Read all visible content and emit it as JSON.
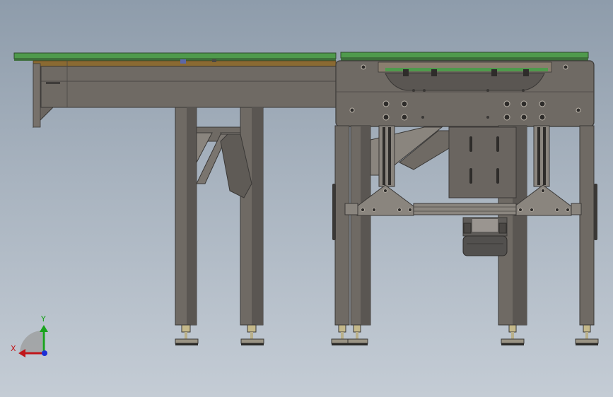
{
  "viewport": {
    "background_top": "#8e9cab",
    "background_bottom": "#c4ccd5",
    "frame_color": "#6f6a64",
    "frame_dark": "#4a4744",
    "belt_color": "#4f9a4c",
    "bracket_color": "#8a7e6e"
  },
  "triad": {
    "x_label": "X",
    "y_label": "Y",
    "x_color": "#c0161a",
    "y_color": "#19a31c",
    "z_color": "#1c2fd6"
  }
}
